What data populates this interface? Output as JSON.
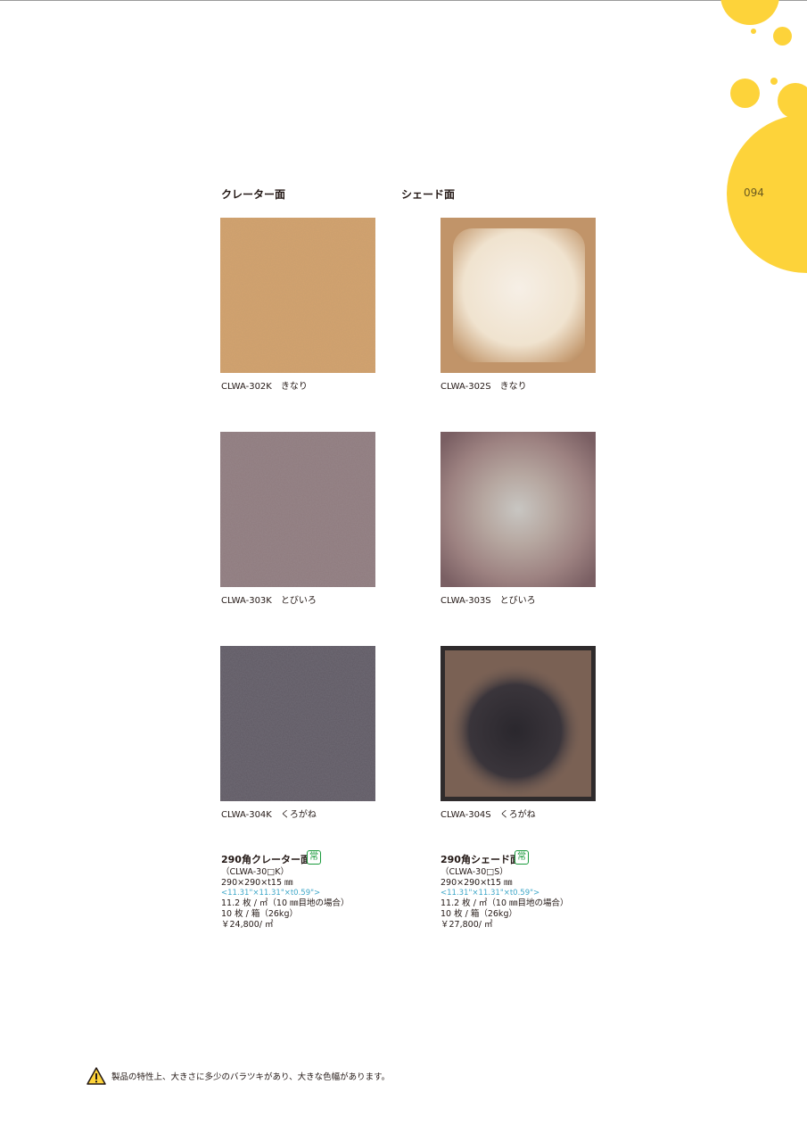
{
  "page": {
    "number": "094"
  },
  "columns": [
    {
      "title": "クレーター面"
    },
    {
      "title": "シェード面"
    }
  ],
  "tiles": [
    {
      "code_name": "CLWA-302K　きなり",
      "finish": "crater",
      "color": "#d4a36f"
    },
    {
      "code_name": "CLWA-302S　きなり",
      "finish": "shade",
      "color": "#f0e3cf"
    },
    {
      "code_name": "CLWA-303K　とびいろ",
      "finish": "crater",
      "color": "#8a7478"
    },
    {
      "code_name": "CLWA-303S　とびいろ",
      "finish": "shade",
      "color": "#9d8281"
    },
    {
      "code_name": "CLWA-304K　くろがね",
      "finish": "crater",
      "color": "#5c5661"
    },
    {
      "code_name": "CLWA-304S　くろがね",
      "finish": "shade",
      "color": "#6e5a52"
    }
  ],
  "specs": [
    {
      "title": "290角クレーター面",
      "badge": "常",
      "series": "（CLWA-30□K）",
      "size_mm": "290×290×t15 ㎜",
      "size_inch": "<11.31\"×11.31\"×t0.59\">",
      "coverage": "11.2 枚 / ㎡（10 ㎜目地の場合）",
      "packing": "10 枚 / 箱（26kg）",
      "price": "￥24,800/ ㎡"
    },
    {
      "title": "290角シェード面",
      "badge": "常",
      "series": "（CLWA-30□S）",
      "size_mm": "290×290×t15 ㎜",
      "size_inch": "<11.31\"×11.31\"×t0.59\">",
      "coverage": "11.2 枚 / ㎡（10 ㎜目地の場合）",
      "packing": "10 枚 / 箱（26kg）",
      "price": "￥27,800/ ㎡"
    }
  ],
  "notice": {
    "icon": "warning-icon",
    "text": "製品の特性上、大きさに多少のバラツキがあり、大きな色幅があります。"
  },
  "colors": {
    "accent_yellow": "#fdd33a",
    "inch_text": "#3ea7c8",
    "badge_green": "#1a9a3c"
  }
}
